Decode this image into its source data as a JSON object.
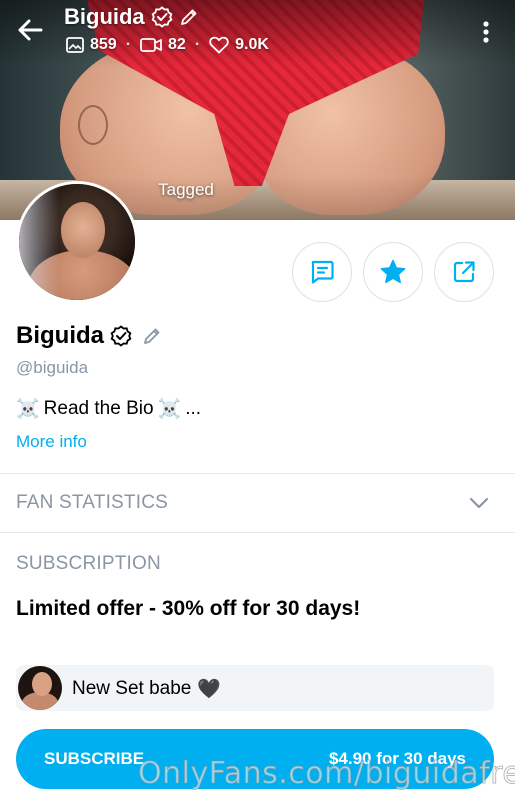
{
  "header": {
    "name": "Biguida",
    "stats": {
      "photos": "859",
      "videos": "82",
      "likes": "9.0K"
    },
    "tagged_label": "Tagged"
  },
  "profile": {
    "name": "Biguida",
    "handle": "@biguida",
    "bio_text": "Read the Bio",
    "bio_suffix": "...",
    "bio_emoji": "☠️",
    "more_info": "More info"
  },
  "sections": {
    "fan_statistics": "FAN STATISTICS",
    "subscription": "SUBSCRIPTION"
  },
  "subscription": {
    "offer": "Limited offer - 30% off for 30 days!",
    "message": "New Set babe",
    "message_emoji": "🖤",
    "button_label": "SUBSCRIBE",
    "button_price": "$4.90 for 30 days"
  },
  "watermark": "OnlyFans.com/biguidafree",
  "colors": {
    "accent": "#00aff0",
    "muted": "#8a96a3",
    "divider": "#e6eaee"
  },
  "icons": [
    "back-arrow-icon",
    "verified-icon",
    "edit-pencil-icon",
    "image-icon",
    "video-icon",
    "heart-icon",
    "more-vertical-icon",
    "message-icon",
    "star-icon",
    "share-icon",
    "chevron-down-icon"
  ]
}
